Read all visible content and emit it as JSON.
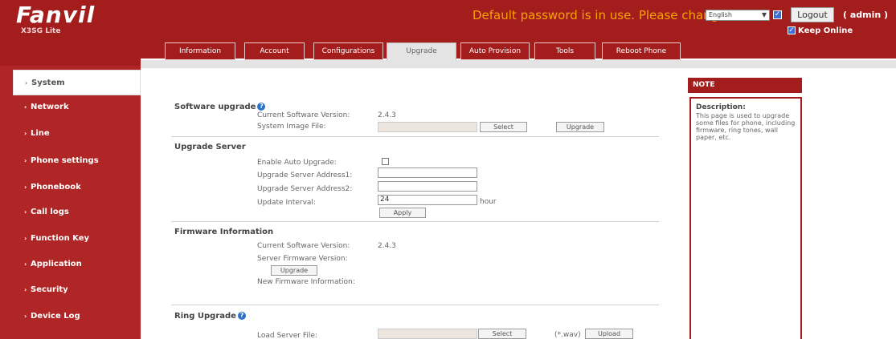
{
  "header": {
    "brand": "Fanvil",
    "model": "X3SG Lite",
    "warning": "Default password is in use. Please change",
    "language": "English",
    "logout_label": "Logout",
    "user_label": "( admin )",
    "keep_online_label": "Keep Online"
  },
  "tabs": [
    "Information",
    "Account",
    "Configurations",
    "Upgrade",
    "Auto Provision",
    "Tools",
    "Reboot Phone"
  ],
  "active_tab": "Upgrade",
  "sidebar": {
    "items": [
      {
        "label": "System"
      },
      {
        "label": "Network"
      },
      {
        "label": "Line"
      },
      {
        "label": "Phone settings"
      },
      {
        "label": "Phonebook"
      },
      {
        "label": "Call logs"
      },
      {
        "label": "Function Key"
      },
      {
        "label": "Application"
      },
      {
        "label": "Security"
      },
      {
        "label": "Device Log"
      }
    ],
    "active": "System"
  },
  "software_upgrade": {
    "title": "Software upgrade",
    "current_version_label": "Current Software Version:",
    "current_version": "2.4.3",
    "image_file_label": "System Image File:",
    "select_label": "Select",
    "upgrade_label": "Upgrade"
  },
  "upgrade_server": {
    "title": "Upgrade Server",
    "enable_label": "Enable Auto Upgrade:",
    "address1_label": "Upgrade Server Address1:",
    "address2_label": "Upgrade Server Address2:",
    "interval_label": "Update Interval:",
    "interval_value": "24",
    "interval_unit": "hour",
    "apply_label": "Apply"
  },
  "firmware_info": {
    "title": "Firmware Information",
    "current_version_label": "Current Software Version:",
    "current_version": "2.4.3",
    "server_version_label": "Server Firmware Version:",
    "upgrade_label": "Upgrade",
    "new_info_label": "New Firmware Information:"
  },
  "ring_upgrade": {
    "title": "Ring Upgrade",
    "load_label": "Load Server File:",
    "select_label": "Select",
    "ext_label": "(*.wav)",
    "upload_label": "Upload"
  },
  "note": {
    "header": "NOTE",
    "title": "Description:",
    "text": "This page is used to upgrade some files for phone, including firmware, ring tones, wall paper, etc."
  },
  "colors": {
    "brand_red": "#a31d1d",
    "warning_orange": "#f7a400",
    "help_blue": "#2a72c8"
  }
}
